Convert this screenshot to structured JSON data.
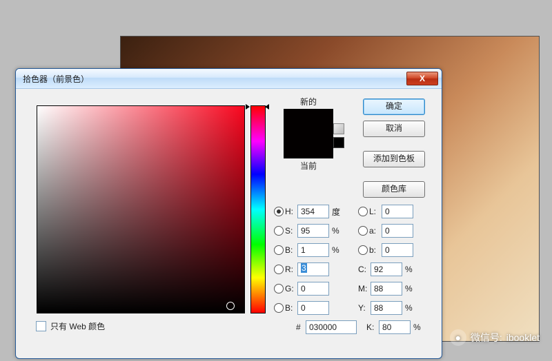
{
  "dialog": {
    "title": "拾色器（前景色）",
    "close_icon": "X"
  },
  "buttons": {
    "ok": "确定",
    "cancel": "取消",
    "add_swatch": "添加到色板",
    "color_lib": "颜色库"
  },
  "swatches": {
    "new_label": "新的",
    "current_label": "当前",
    "new_color": "#030000",
    "current_color": "#030000"
  },
  "hsb": {
    "h_label": "H:",
    "h_value": "354",
    "h_unit": "度",
    "s_label": "S:",
    "s_value": "95",
    "s_unit": "%",
    "b_label": "B:",
    "b_value": "1",
    "b_unit": "%"
  },
  "lab": {
    "l_label": "L:",
    "l_value": "0",
    "a_label": "a:",
    "a_value": "0",
    "b_label": "b:",
    "b_value": "0"
  },
  "rgb": {
    "r_label": "R:",
    "r_value": "3",
    "g_label": "G:",
    "g_value": "0",
    "b_label": "B:",
    "b_value": "0"
  },
  "cmyk": {
    "c_label": "C:",
    "c_value": "92",
    "unit": "%",
    "m_label": "M:",
    "m_value": "88",
    "y_label": "Y:",
    "y_value": "88",
    "k_label": "K:",
    "k_value": "80"
  },
  "hex": {
    "prefix": "#",
    "value": "030000"
  },
  "webonly": {
    "label": "只有 Web 颜色",
    "checked": false
  },
  "watermark": {
    "label": "微信号:",
    "value": "ibooklet"
  }
}
